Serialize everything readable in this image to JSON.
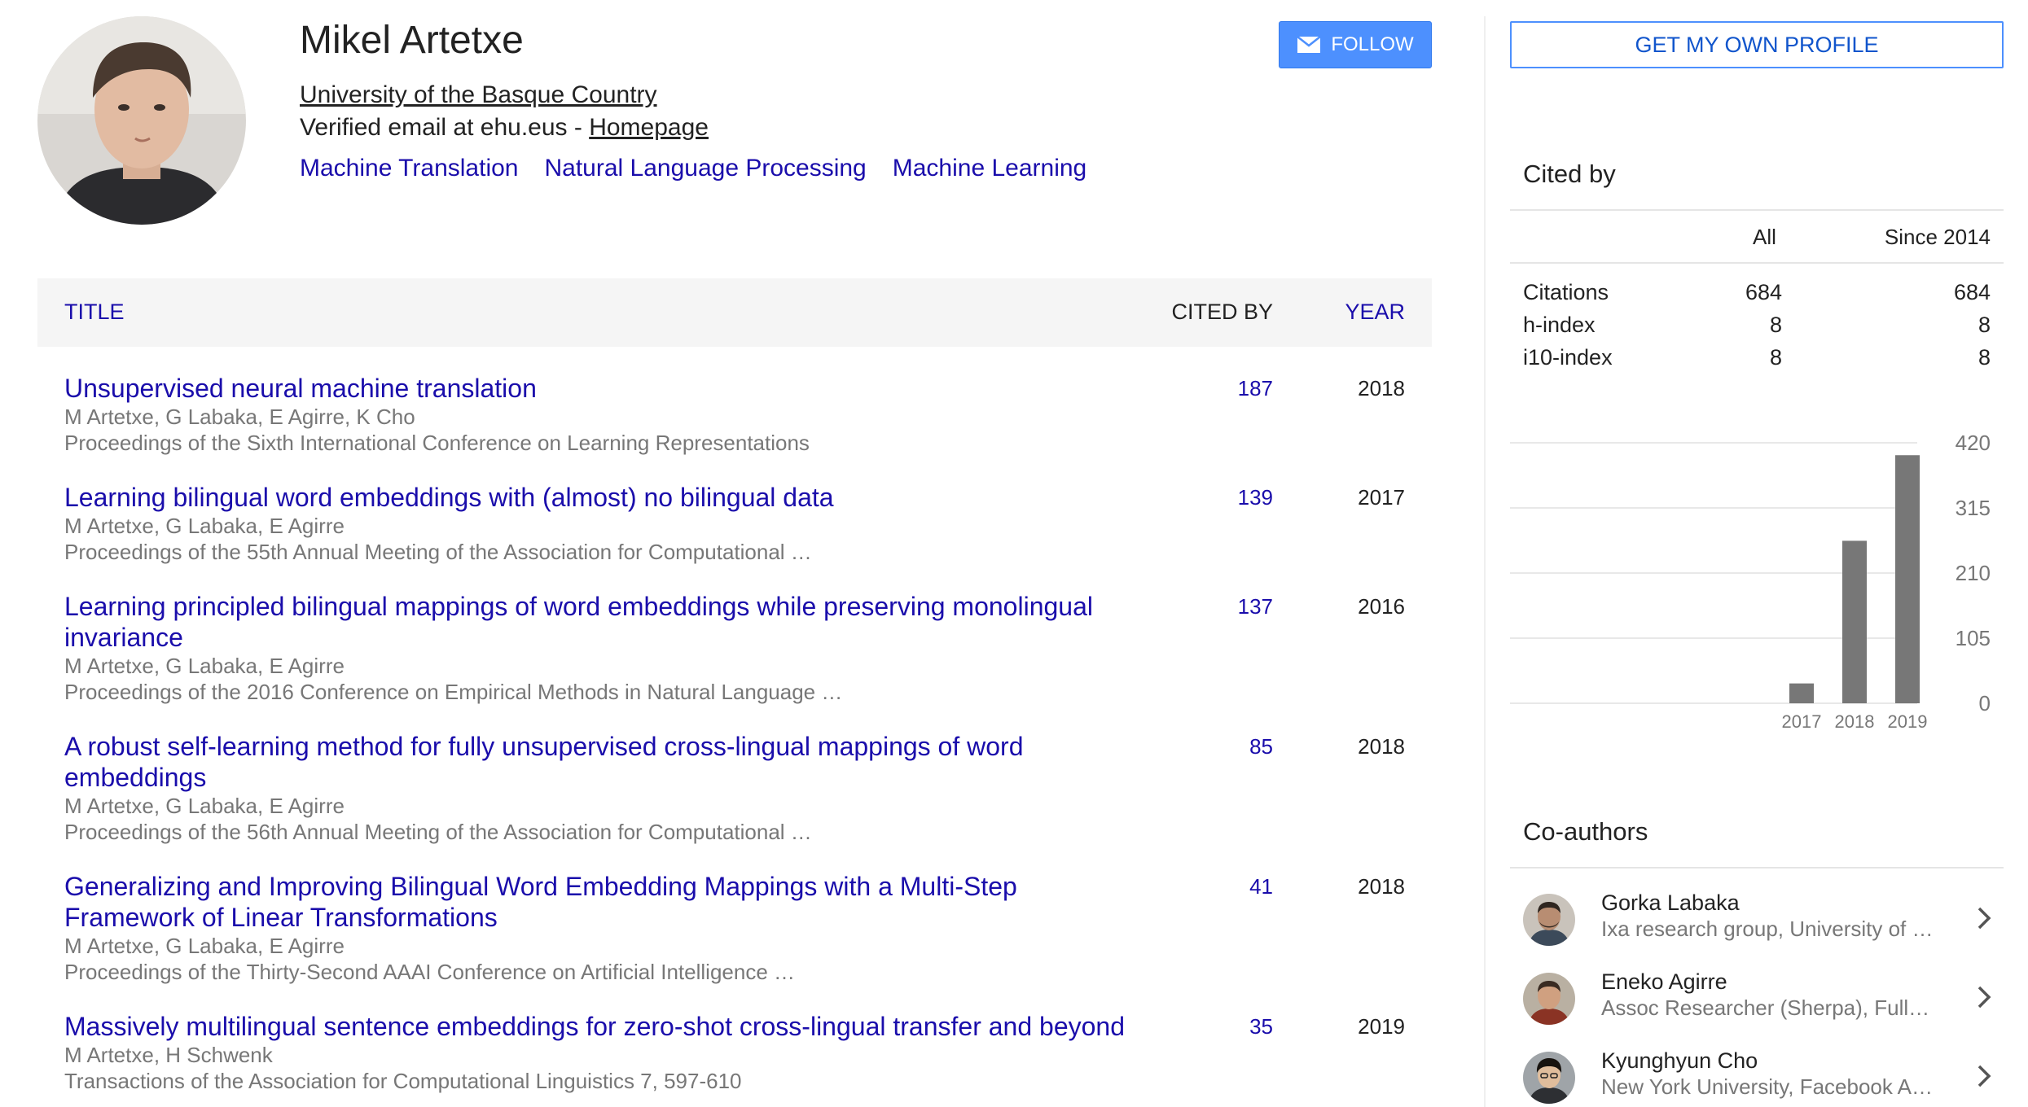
{
  "profile": {
    "name": "Mikel Artetxe",
    "affiliation": "University of the Basque Country",
    "email_prefix": "Verified email at ehu.eus - ",
    "homepage_label": "Homepage",
    "interests": [
      "Machine Translation",
      "Natural Language Processing",
      "Machine Learning"
    ],
    "follow_label": "FOLLOW"
  },
  "table": {
    "header": {
      "title": "TITLE",
      "cited_by": "CITED BY",
      "year": "YEAR"
    },
    "rows": [
      {
        "title": "Unsupervised neural machine translation",
        "authors": "M Artetxe, G Labaka, E Agirre, K Cho",
        "venue": "Proceedings of the Sixth International Conference on Learning Representations",
        "cited_by": "187",
        "year": "2018"
      },
      {
        "title": "Learning bilingual word embeddings with (almost) no bilingual data",
        "authors": "M Artetxe, G Labaka, E Agirre",
        "venue": "Proceedings of the 55th Annual Meeting of the Association for Computational …",
        "cited_by": "139",
        "year": "2017"
      },
      {
        "title": "Learning principled bilingual mappings of word embeddings while preserving monolingual invariance",
        "authors": "M Artetxe, G Labaka, E Agirre",
        "venue": "Proceedings of the 2016 Conference on Empirical Methods in Natural Language …",
        "cited_by": "137",
        "year": "2016"
      },
      {
        "title": "A robust self-learning method for fully unsupervised cross-lingual mappings of word embeddings",
        "authors": "M Artetxe, G Labaka, E Agirre",
        "venue": "Proceedings of the 56th Annual Meeting of the Association for Computational …",
        "cited_by": "85",
        "year": "2018"
      },
      {
        "title": "Generalizing and Improving Bilingual Word Embedding Mappings with a Multi-Step Framework of Linear Transformations",
        "authors": "M Artetxe, G Labaka, E Agirre",
        "venue": "Proceedings of the Thirty-Second AAAI Conference on Artificial Intelligence …",
        "cited_by": "41",
        "year": "2018"
      },
      {
        "title": "Massively multilingual sentence embeddings for zero-shot cross-lingual transfer and beyond",
        "authors": "M Artetxe, H Schwenk",
        "venue": "Transactions of the Association for Computational Linguistics 7, 597-610",
        "cited_by": "35",
        "year": "2019"
      }
    ]
  },
  "sidebar": {
    "own_profile_label": "GET MY OWN PROFILE",
    "cited_by_title": "Cited by",
    "col_all": "All",
    "col_since": "Since 2014",
    "stats": [
      {
        "label": "Citations",
        "all": "684",
        "since": "684"
      },
      {
        "label": "h-index",
        "all": "8",
        "since": "8"
      },
      {
        "label": "i10-index",
        "all": "8",
        "since": "8"
      }
    ],
    "coauthors_title": "Co-authors",
    "coauthors": [
      {
        "name": "Gorka Labaka",
        "affiliation": "Ixa research group, University of …"
      },
      {
        "name": "Eneko Agirre",
        "affiliation": "Assoc Researcher (Sherpa), Full…"
      },
      {
        "name": "Kyunghyun Cho",
        "affiliation": "New York University, Facebook A…"
      }
    ]
  },
  "chart_data": {
    "type": "bar",
    "categories": [
      "2017",
      "2018",
      "2019"
    ],
    "values": [
      32,
      262,
      400
    ],
    "y_ticks": [
      "0",
      "105",
      "210",
      "315",
      "420"
    ],
    "ylim": [
      0,
      420
    ],
    "grid": true,
    "bar_color": "#777777"
  },
  "colors": {
    "link": "#1a0dab",
    "button": "#4d90fe",
    "bar": "#777777"
  }
}
